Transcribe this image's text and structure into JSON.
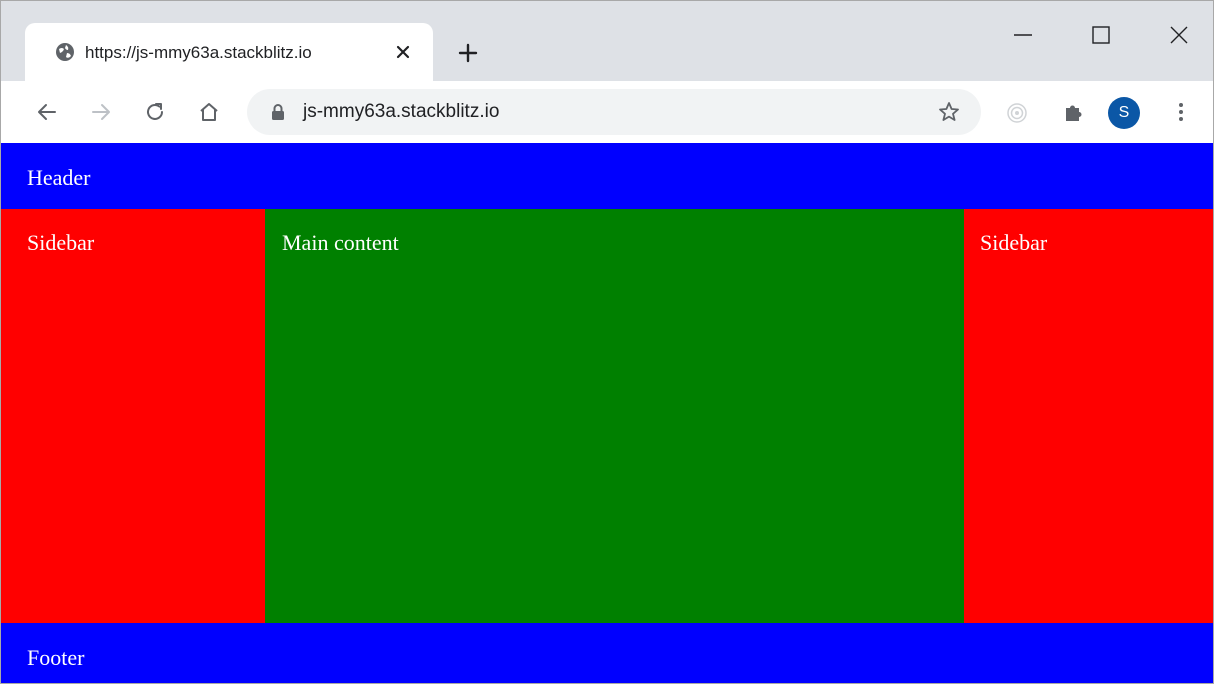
{
  "browser": {
    "tab": {
      "title": "https://js-mmy63a.stackblitz.io",
      "favicon": "globe-icon",
      "close_icon": "close-icon"
    },
    "new_tab_icon": "plus-icon",
    "window_controls": [
      "minimize-icon",
      "maximize-icon",
      "close-icon"
    ],
    "toolbar": {
      "back_icon": "arrow-left-icon",
      "forward_icon": "arrow-right-icon",
      "reload_icon": "reload-icon",
      "home_icon": "home-icon",
      "url": "js-mmy63a.stackblitz.io",
      "lock_icon": "lock-icon",
      "bookmark_icon": "star-icon",
      "extensions": [
        "extension-target-icon",
        "puzzle-icon"
      ],
      "profile_initial": "S",
      "menu_icon": "kebab-menu-icon"
    }
  },
  "page": {
    "header": "Header",
    "sidebar_left": "Sidebar",
    "main": "Main content",
    "sidebar_right": "Sidebar",
    "footer": "Footer"
  },
  "colors": {
    "header_footer": "#0000ff",
    "sidebar": "#ff0000",
    "main": "#008000",
    "tabstrip": "#dee1e6",
    "omnibox": "#f1f3f4",
    "avatar": "#0b57a6"
  }
}
